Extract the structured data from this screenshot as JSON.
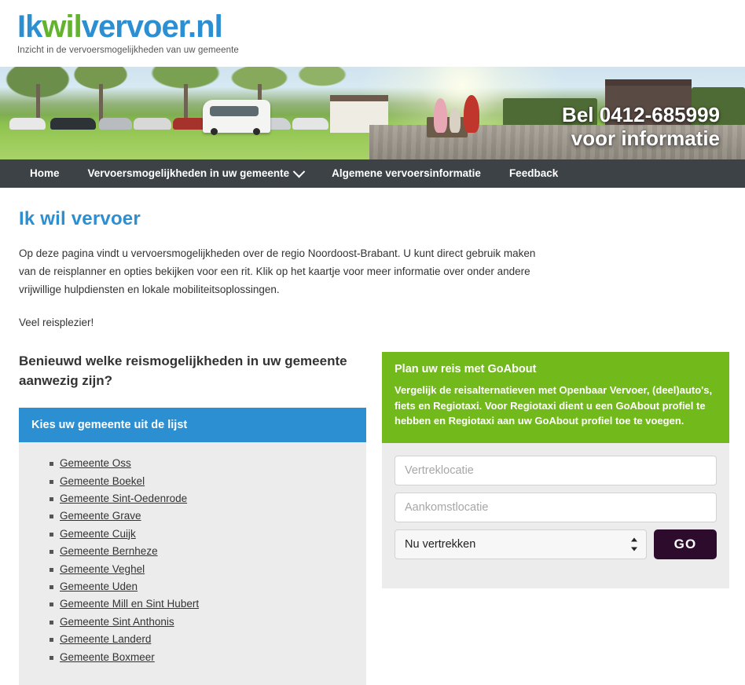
{
  "header": {
    "logo": {
      "part1": "Ik",
      "part2": "wil",
      "part3": "vervoer.nl",
      "tagline": "Inzicht in de vervoersmogelijkheden van uw gemeente",
      "blue": "#2b8fd1",
      "green": "#63b32e"
    }
  },
  "hero": {
    "phone_line1": "Bel 0412-685999",
    "phone_line2": "voor informatie"
  },
  "nav": {
    "background": "#3d4247",
    "items": [
      {
        "label": "Home",
        "has_chevron": false
      },
      {
        "label": "Vervoersmogelijkheden in uw gemeente",
        "has_chevron": true
      },
      {
        "label": "Algemene vervoersinformatie",
        "has_chevron": false
      },
      {
        "label": "Feedback",
        "has_chevron": false
      }
    ]
  },
  "main": {
    "page_title": "Ik wil vervoer",
    "intro_paragraph": "Op deze pagina vindt u vervoersmogelijkheden over de regio Noordoost-Brabant. U kunt direct gebruik maken van de reisplanner en opties bekijken voor een rit. Klik op het kaartje voor meer informatie over onder andere vrijwillige hulpdiensten en lokale mobiliteitsoplossingen.",
    "intro_closing": "Veel reisplezier!",
    "sub_title": "Benieuwd welke reismogelijkheden in uw gemeente aanwezig zijn?"
  },
  "gemeente_panel": {
    "header": "Kies uw gemeente uit de lijst",
    "header_color": "#2b8fd1",
    "items": [
      "Gemeente Oss",
      "Gemeente Boekel",
      "Gemeente Sint-Oedenrode",
      "Gemeente Grave",
      "Gemeente Cuijk",
      "Gemeente Bernheze",
      "Gemeente Veghel",
      "Gemeente Uden",
      "Gemeente Mill en Sint Hubert",
      "Gemeente Sint Anthonis",
      "Gemeente Landerd",
      "Gemeente Boxmeer"
    ]
  },
  "goabout_panel": {
    "title": "Plan uw reis met GoAbout",
    "description": "Vergelijk de reisalternatieven met Openbaar Vervoer, (deel)auto's, fiets en Regiotaxi. Voor Regiotaxi dient u een GoAbout profiel te hebben en Regiotaxi aan uw GoAbout profiel toe te voegen.",
    "header_color": "#72b91c",
    "form": {
      "departure_placeholder": "Vertreklocatie",
      "departure_value": "",
      "arrival_placeholder": "Aankomstlocatie",
      "arrival_value": "",
      "time_selected": "Nu vertrekken",
      "time_options": [
        "Nu vertrekken"
      ],
      "go_label": "GO",
      "go_color": "#2d0b2d"
    }
  }
}
